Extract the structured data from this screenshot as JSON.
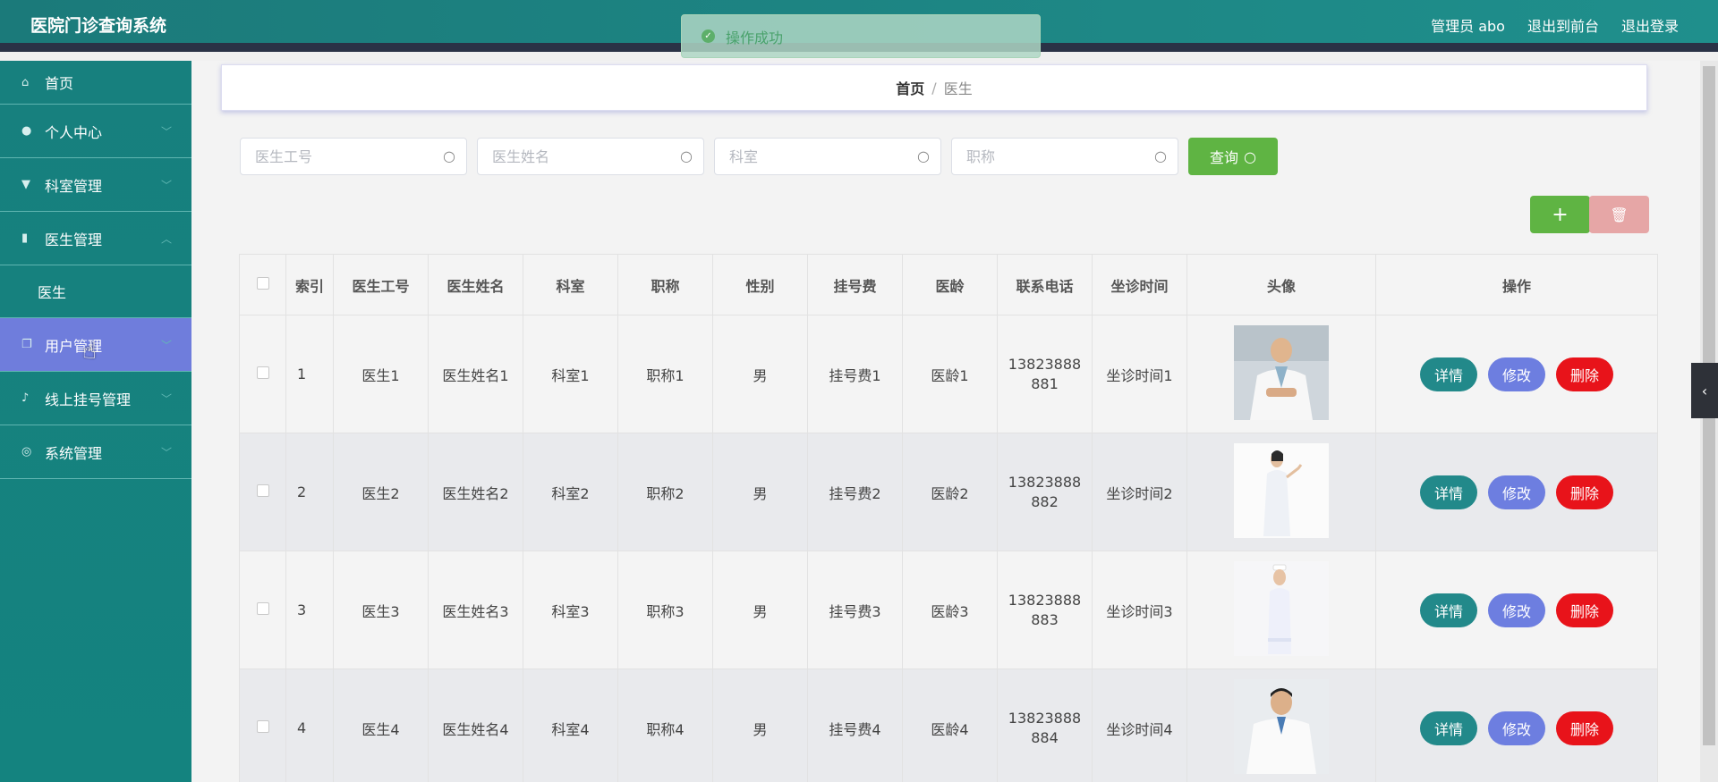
{
  "app": {
    "title": "医院门诊查询系统"
  },
  "header": {
    "user": "管理员 abo",
    "to_front": "退出到前台",
    "logout": "退出登录"
  },
  "toast": {
    "message": "操作成功"
  },
  "sidebar": {
    "items": [
      {
        "label": "首页",
        "icon": "home-icon"
      },
      {
        "label": "个人中心",
        "icon": "person-icon"
      },
      {
        "label": "科室管理",
        "icon": "dept-icon"
      },
      {
        "label": "医生管理",
        "icon": "chart-icon"
      },
      {
        "label": "用户管理",
        "icon": "copy-icon"
      },
      {
        "label": "线上挂号管理",
        "icon": "bell-icon"
      },
      {
        "label": "系统管理",
        "icon": "compass-icon"
      }
    ],
    "submenu": {
      "label": "医生"
    }
  },
  "breadcrumb": {
    "home": "首页",
    "separator": "/",
    "current": "医生"
  },
  "search": {
    "fields": [
      {
        "placeholder": "医生工号"
      },
      {
        "placeholder": "医生姓名"
      },
      {
        "placeholder": "科室"
      },
      {
        "placeholder": "职称"
      }
    ],
    "button_label": "查询"
  },
  "actions": {
    "add": "+",
    "delete": "🗑"
  },
  "table": {
    "headers": [
      "索引",
      "医生工号",
      "医生姓名",
      "科室",
      "职称",
      "性别",
      "挂号费",
      "医龄",
      "联系电话",
      "坐诊时间",
      "头像",
      "操作"
    ],
    "rows": [
      {
        "index": "1",
        "id": "医生1",
        "name": "医生姓名1",
        "dept": "科室1",
        "title": "职称1",
        "gender": "男",
        "fee": "挂号费1",
        "years": "医龄1",
        "phone_a": "13823888",
        "phone_b": "881",
        "time": "坐诊时间1"
      },
      {
        "index": "2",
        "id": "医生2",
        "name": "医生姓名2",
        "dept": "科室2",
        "title": "职称2",
        "gender": "男",
        "fee": "挂号费2",
        "years": "医龄2",
        "phone_a": "13823888",
        "phone_b": "882",
        "time": "坐诊时间2"
      },
      {
        "index": "3",
        "id": "医生3",
        "name": "医生姓名3",
        "dept": "科室3",
        "title": "职称3",
        "gender": "男",
        "fee": "挂号费3",
        "years": "医龄3",
        "phone_a": "13823888",
        "phone_b": "883",
        "time": "坐诊时间3"
      },
      {
        "index": "4",
        "id": "医生4",
        "name": "医生姓名4",
        "dept": "科室4",
        "title": "职称4",
        "gender": "男",
        "fee": "挂号费4",
        "years": "医龄4",
        "phone_a": "13823888",
        "phone_b": "884",
        "time": "坐诊时间4"
      }
    ],
    "op_labels": {
      "detail": "详情",
      "edit": "修改",
      "delete": "删除"
    }
  },
  "colors": {
    "header": "#1b7a7a",
    "sidebar": "#17807e",
    "active_menu": "#6f7ddc",
    "success": "#5fb443",
    "danger": "#e8131a"
  }
}
